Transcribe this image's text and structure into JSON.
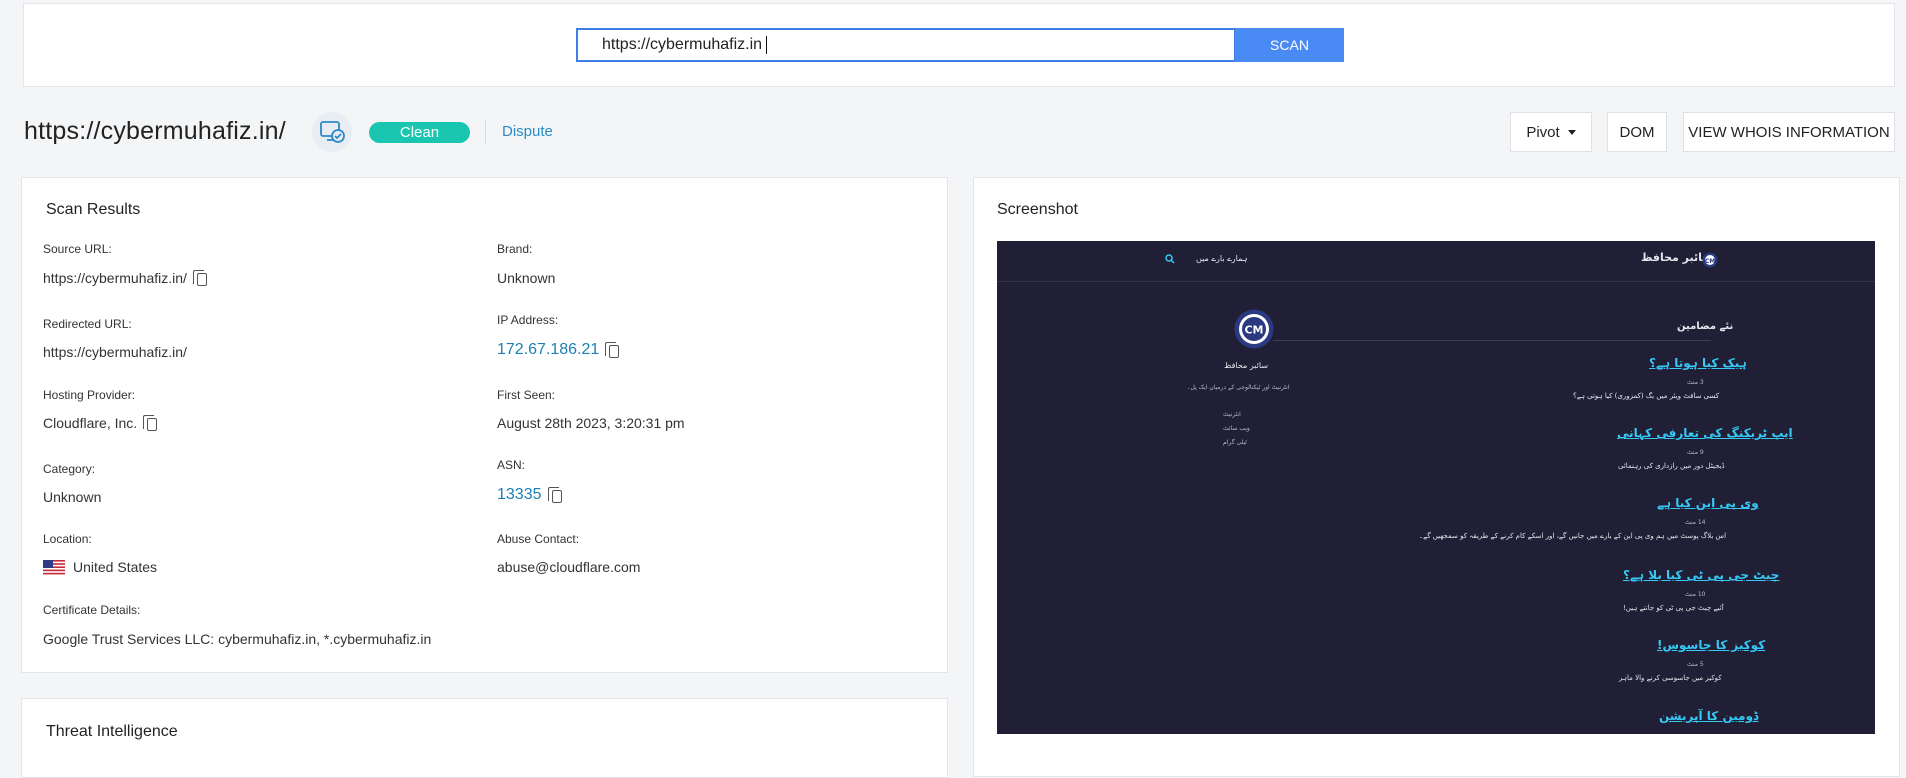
{
  "scan": {
    "input_value": "https://cybermuhafiz.in",
    "button_label": "SCAN"
  },
  "header": {
    "url": "https://cybermuhafiz.in/",
    "verdict": "Clean",
    "dispute": "Dispute",
    "buttons": {
      "pivot": "Pivot",
      "dom": "DOM",
      "whois": "VIEW WHOIS INFORMATION"
    }
  },
  "scan_results": {
    "title": "Scan Results",
    "source_url": {
      "label": "Source URL:",
      "value": "https://cybermuhafiz.in/"
    },
    "redirected_url": {
      "label": "Redirected URL:",
      "value": "https://cybermuhafiz.in/"
    },
    "hosting_provider": {
      "label": "Hosting Provider:",
      "value": "Cloudflare, Inc."
    },
    "category": {
      "label": "Category:",
      "value": "Unknown"
    },
    "location": {
      "label": "Location:",
      "value": "United States"
    },
    "certificate": {
      "label": "Certificate Details:",
      "value": "Google Trust Services LLC: cybermuhafiz.in, *.cybermuhafiz.in"
    },
    "brand": {
      "label": "Brand:",
      "value": "Unknown"
    },
    "ip_address": {
      "label": "IP Address:",
      "value": "172.67.186.21"
    },
    "first_seen": {
      "label": "First Seen:",
      "value": "August 28th 2023, 3:20:31 pm"
    },
    "asn": {
      "label": "ASN:",
      "value": "13335"
    },
    "abuse_contact": {
      "label": "Abuse Contact:",
      "value": "abuse@cloudflare.com"
    }
  },
  "threat_intel": {
    "title": "Threat Intelligence"
  },
  "screenshot": {
    "title": "Screenshot",
    "site": {
      "brand": "سائبر محافظ",
      "nav_about": "ہمارے بارے میں",
      "latest": "نئے مضامین",
      "profile_name": "سائبر محافظ",
      "profile_tagline": "انٹرنیٹ اور ٹیکنالوجی کے درمیان ایک پل۔",
      "profile_links": [
        "انٹرنیٹ",
        "ویب سائٹ",
        "ٹیلی گرام"
      ],
      "articles": [
        {
          "title": "ہیک کیا ہوتا ہے؟",
          "meta": "3 منٹ",
          "excerpt": "کسی سافٹ ویئر میں بگ (کمزوری) کیا ہوتی ہے؟"
        },
        {
          "title": "ایپ ٹریکنگ کی تعارفی کہانی",
          "meta": "9 منٹ",
          "excerpt": "ڈیجیٹل دور میں رازداری کی رہنمائی"
        },
        {
          "title": "وی پی این کیا ہے",
          "meta": "14 منٹ",
          "excerpt": "اس بلاگ پوسٹ میں ہم وی پی این کے بارے میں جانیں گے، اور اسکے کام کرنے کے طریقہ کو سمجھیں گے۔"
        },
        {
          "title": "چیٹ جی پی ٹی کیا بلا ہے؟",
          "meta": "10 منٹ",
          "excerpt": "آئیے چیٹ جی پی ٹی کو جانتے ہیں!"
        },
        {
          "title": "کوکیز کا جاسوس!",
          "meta": "5 منٹ",
          "excerpt": "کوکیز میں جاسوسی کرنے والا ماہر"
        },
        {
          "title": "ڈومین کا آپریشن",
          "meta": "",
          "excerpt": ""
        }
      ]
    }
  },
  "colors": {
    "accent": "#4a8af4",
    "clean": "#1ac6b0",
    "link": "#1b7fb6",
    "shot_bg": "#201f35"
  }
}
